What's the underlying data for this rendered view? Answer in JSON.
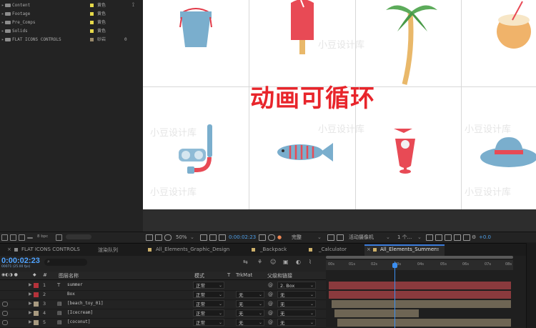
{
  "project": {
    "items": [
      {
        "name": "Content",
        "label": "黄色",
        "color": "#e6d94a"
      },
      {
        "name": "Footage",
        "label": "黄色",
        "color": "#e6d94a"
      },
      {
        "name": "Pre_Comps",
        "label": "黄色",
        "color": "#e6d94a"
      },
      {
        "name": "Solids",
        "label": "黄色",
        "color": "#e6d94a"
      },
      {
        "name": "FLAT ICONS CONTROLS",
        "label": "砂岩",
        "color": "#9a8a6a",
        "extra": "0"
      }
    ],
    "bpc": "8 bpc"
  },
  "viewer": {
    "headline": "动画可循环",
    "watermark": "小豆设计库",
    "toolbar": {
      "zoom": "50%",
      "timecode": "0:00:02:23",
      "resolution": "完整",
      "camera": "活动摄像机",
      "views": "1 个...",
      "exposure": "+0.0"
    }
  },
  "timeline": {
    "tabs": [
      {
        "label": "FLAT ICONS CONTROLS",
        "active": false
      },
      {
        "label": "渲染队列",
        "active": false
      },
      {
        "label": "All_Elements_Graphic_Design",
        "active": false
      },
      {
        "label": "_Backpack",
        "active": false
      },
      {
        "label": "_Calculator",
        "active": false
      },
      {
        "label": "All_Elements_Summer",
        "active": true
      }
    ],
    "timecode": "0:00:02:23",
    "frames": "00071 (25.00 fps)",
    "columns": {
      "hash": "#",
      "layer_name": "图层名称",
      "mode": "模式",
      "t": "T",
      "trkmat": "TrkMat",
      "parent": "父级和链接"
    },
    "layers": [
      {
        "num": "1",
        "type": "T",
        "name": "summer",
        "mode": "正常",
        "trkmat": "",
        "parent": "2. Box",
        "color": "#b5323a"
      },
      {
        "num": "2",
        "type": "",
        "name": "Box",
        "mode": "正常",
        "trkmat": "无",
        "parent": "无",
        "color": "#b5323a"
      },
      {
        "num": "3",
        "type": "",
        "name": "[beach_toy_01]",
        "mode": "正常",
        "trkmat": "无",
        "parent": "无",
        "color": "#a89a80"
      },
      {
        "num": "4",
        "type": "",
        "name": "[Icecream]",
        "mode": "正常",
        "trkmat": "无",
        "parent": "无",
        "color": "#a89a80"
      },
      {
        "num": "5",
        "type": "",
        "name": "[coconut]",
        "mode": "正常",
        "trkmat": "无",
        "parent": "无",
        "color": "#a89a80"
      }
    ],
    "ruler_ticks": [
      "00s",
      "01s",
      "02s",
      "03s",
      "04s",
      "05s",
      "06s",
      "07s",
      "08s"
    ],
    "bar_colors": {
      "red": "#8a3a3d",
      "tan": "#6e6554"
    }
  }
}
